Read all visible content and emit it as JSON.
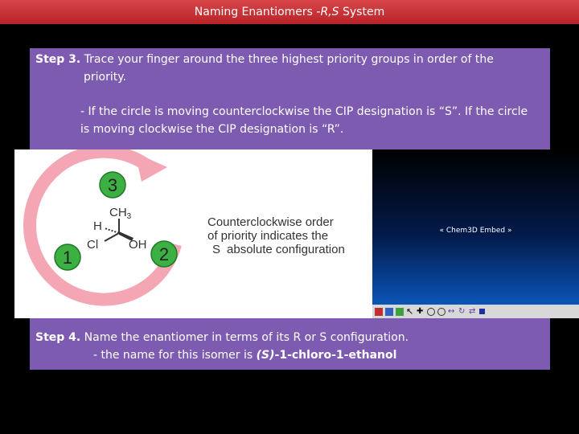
{
  "title": {
    "prefix": "Naming Enantiomers -",
    "italic": "R,S",
    "suffix": " System"
  },
  "step3": {
    "label": "Step 3.",
    "line1": " Trace your finger around the three highest priority groups in order of the",
    "line2": "priority.",
    "bullet1": "- If the circle is moving counterclockwise the CIP designation is “S”.  If the circle",
    "bullet2": "is moving clockwise the CIP designation is “R”."
  },
  "diagram": {
    "priority3": "3",
    "priority2": "2",
    "priority1": "1",
    "ch3": "CH",
    "ch3_sub": "3",
    "h": "H",
    "cl": "Cl",
    "oh": "OH",
    "caption1": "Counterclockwise order",
    "caption2": "of priority indicates the",
    "caption3_s": "S",
    "caption3_rest": "absolute configuration",
    "arrow_color": "#f4a6b4",
    "circle_color": "#3cb043"
  },
  "embed": {
    "label": "« Chem3D Embed »"
  },
  "step4": {
    "label": "Step 4.",
    "line1": " Name the enantiomer in terms of its  R or S configuration.",
    "line2_prefix": "- the name for this isomer is ",
    "line2_italic": "(S)",
    "line2_bold": "-1-chloro-1-ethanol"
  }
}
